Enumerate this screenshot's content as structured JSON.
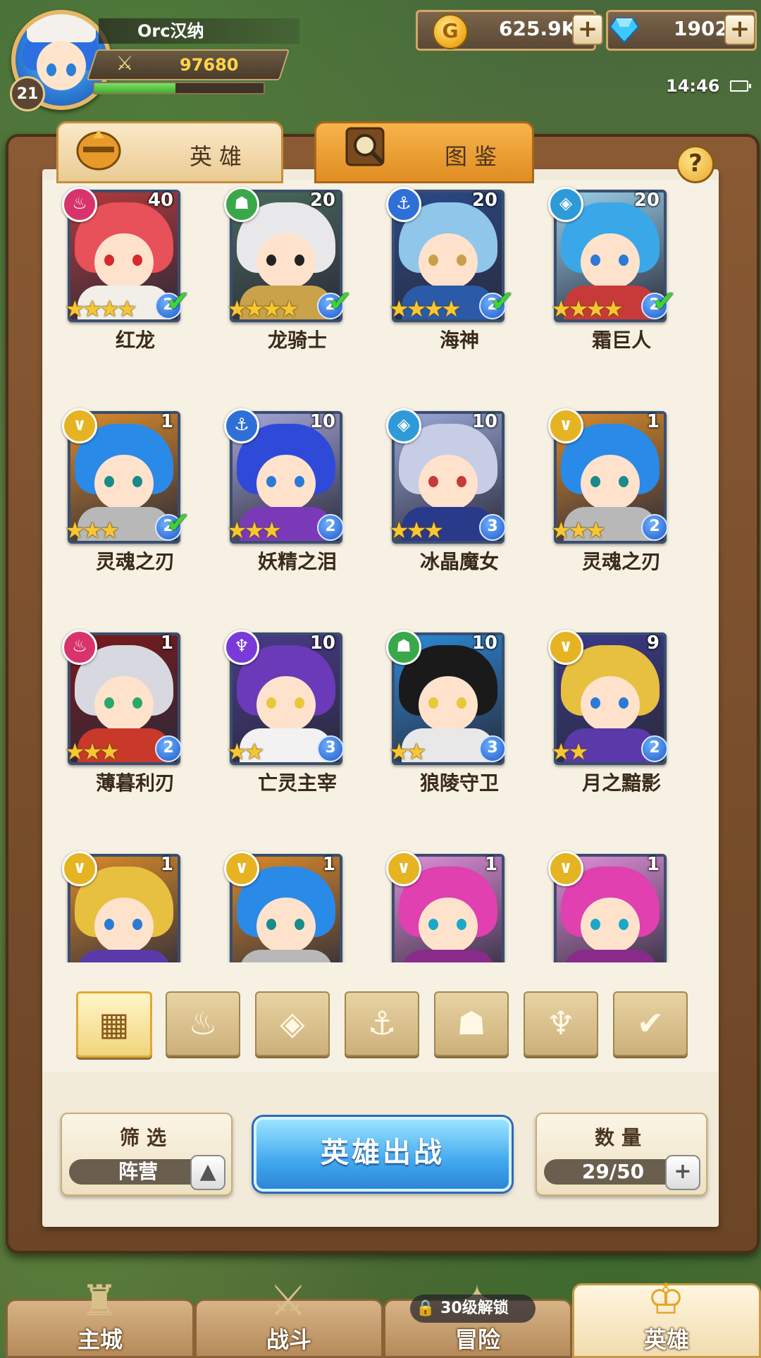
{
  "player": {
    "name": "Orc汉纳",
    "level": "21",
    "power": "97680",
    "exp_fraction": 0.48
  },
  "resources": {
    "gold": "625.9K",
    "gems": "1902"
  },
  "status": {
    "time": "14:46"
  },
  "tabs": [
    {
      "label": "英雄",
      "icon": "knight-helmet-icon"
    },
    {
      "label": "图鉴",
      "icon": "magnifier-book-icon"
    }
  ],
  "heroes": [
    {
      "name": "红龙",
      "level": "40",
      "stars": 4,
      "rank": "2",
      "deployed": true,
      "faction": "fire",
      "faction_color": "#d8336b",
      "hair": "#e8505a",
      "bg": "#b23a3a",
      "eye": "#d8282e",
      "body": "#f2efe8"
    },
    {
      "name": "龙骑士",
      "level": "20",
      "stars": 4,
      "rank": "2",
      "deployed": true,
      "faction": "beast",
      "faction_color": "#3aa84a",
      "hair": "#e8e8ea",
      "bg": "#4a6a5a",
      "eye": "#222",
      "body": "#c9a24a"
    },
    {
      "name": "海神",
      "level": "20",
      "stars": 4,
      "rank": "2",
      "deployed": true,
      "faction": "anchor",
      "faction_color": "#2f6fd8",
      "hair": "#8fc6ea",
      "bg": "#2a4a8a",
      "eye": "#c9a04a",
      "body": "#2a5aa8"
    },
    {
      "name": "霜巨人",
      "level": "20",
      "stars": 4,
      "rank": "2",
      "deployed": true,
      "faction": "ice",
      "faction_color": "#2f9ad8",
      "hair": "#3aa8e8",
      "bg": "#9ad0ea",
      "eye": "#2a7ad6",
      "body": "#c83a3a"
    },
    {
      "name": "灵魂之刃",
      "level": "1",
      "stars": 3,
      "rank": "2",
      "deployed": true,
      "faction": "light",
      "faction_color": "#e6b322",
      "hair": "#2a8ae8",
      "bg": "#d98a2a",
      "eye": "#1a8a8a",
      "body": "#b8b8b8"
    },
    {
      "name": "妖精之泪",
      "level": "10",
      "stars": 3,
      "rank": "2",
      "deployed": false,
      "faction": "anchor",
      "faction_color": "#2f6fd8",
      "hair": "#2f4ad8",
      "bg": "#a6a6d8",
      "eye": "#2a7ad6",
      "body": "#7a3ab8"
    },
    {
      "name": "冰晶魔女",
      "level": "10",
      "stars": 3,
      "rank": "3",
      "deployed": false,
      "faction": "ice",
      "faction_color": "#2f9ad8",
      "hair": "#c8cde6",
      "bg": "#9aa8d8",
      "eye": "#c83a3a",
      "body": "#2a3a8a"
    },
    {
      "name": "灵魂之刃",
      "level": "1",
      "stars": 3,
      "rank": "2",
      "deployed": false,
      "faction": "light",
      "faction_color": "#e6b322",
      "hair": "#2a8ae8",
      "bg": "#d98a2a",
      "eye": "#1a8a8a",
      "body": "#b8b8b8"
    },
    {
      "name": "薄暮利刃",
      "level": "1",
      "stars": 3,
      "rank": "2",
      "deployed": false,
      "faction": "fire",
      "faction_color": "#d8336b",
      "hair": "#d8d8e0",
      "bg": "#7a1a1a",
      "eye": "#2aa86a",
      "body": "#c8392a"
    },
    {
      "name": "亡灵主宰",
      "level": "10",
      "stars": 2,
      "rank": "3",
      "deployed": false,
      "faction": "dark",
      "faction_color": "#7a3ad8",
      "hair": "#6a3ab8",
      "bg": "#4a3a8a",
      "eye": "#e8c83a",
      "body": "#f2f2f2"
    },
    {
      "name": "狼陵守卫",
      "level": "10",
      "stars": 2,
      "rank": "3",
      "deployed": false,
      "faction": "beast",
      "faction_color": "#3aa84a",
      "hair": "#1a1a1a",
      "bg": "#2a8ad8",
      "eye": "#e8c83a",
      "body": "#e8e8e8"
    },
    {
      "name": "月之黯影",
      "level": "9",
      "stars": 2,
      "rank": "2",
      "deployed": false,
      "faction": "light",
      "faction_color": "#e6b322",
      "hair": "#e8c040",
      "bg": "#3a3a8a",
      "eye": "#2a7ad6",
      "body": "#5a3aa8"
    },
    {
      "name": "",
      "level": "1",
      "stars": 0,
      "rank": "",
      "deployed": false,
      "faction": "light",
      "faction_color": "#e6b322",
      "hair": "#e8c040",
      "bg": "#d98a2a",
      "eye": "#2a7ad6",
      "body": "#5a3aa8"
    },
    {
      "name": "",
      "level": "1",
      "stars": 0,
      "rank": "",
      "deployed": false,
      "faction": "light",
      "faction_color": "#e6b322",
      "hair": "#2a8ae8",
      "bg": "#d98a2a",
      "eye": "#1a8a8a",
      "body": "#b8b8b8"
    },
    {
      "name": "",
      "level": "1",
      "stars": 0,
      "rank": "",
      "deployed": false,
      "faction": "light",
      "faction_color": "#e6b322",
      "hair": "#e040b0",
      "bg": "#e090d8",
      "eye": "#1aa8c8",
      "body": "#8a2a8a"
    },
    {
      "name": "",
      "level": "1",
      "stars": 0,
      "rank": "",
      "deployed": false,
      "faction": "light",
      "faction_color": "#e6b322",
      "hair": "#e040b0",
      "bg": "#e090d8",
      "eye": "#1aa8c8",
      "body": "#8a2a8a"
    }
  ],
  "faction_filters": [
    {
      "icon": "grid-all-icon",
      "glyph": "▦",
      "active": true
    },
    {
      "icon": "flame-faction-icon",
      "glyph": "♨",
      "active": false
    },
    {
      "icon": "ice-crystal-faction-icon",
      "glyph": "◈",
      "active": false
    },
    {
      "icon": "anchor-faction-icon",
      "glyph": "⚓",
      "active": false
    },
    {
      "icon": "beast-faction-icon",
      "glyph": "☗",
      "active": false
    },
    {
      "icon": "dark-horns-faction-icon",
      "glyph": "♆",
      "active": false
    },
    {
      "icon": "light-wings-faction-icon",
      "glyph": "✔",
      "active": false
    }
  ],
  "filter_box": {
    "title": "筛选",
    "value": "阵营"
  },
  "deploy_button": {
    "label": "英雄出战"
  },
  "count_box": {
    "title": "数量",
    "value": "29/50"
  },
  "nav": [
    {
      "label": "主城",
      "icon": "castle-icon",
      "glyph": "♜",
      "active": false
    },
    {
      "label": "战斗",
      "icon": "crossed-swords-icon",
      "glyph": "⚔",
      "active": false
    },
    {
      "label": "冒险",
      "icon": "adventure-icon",
      "glyph": "✦",
      "active": false,
      "lock_text": "30级解锁"
    },
    {
      "label": "英雄",
      "icon": "hero-helmet-icon",
      "glyph": "♔",
      "active": true
    }
  ]
}
